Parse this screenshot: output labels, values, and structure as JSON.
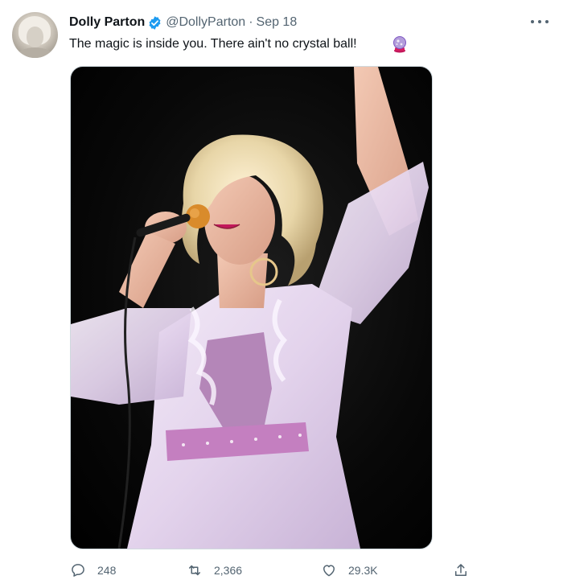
{
  "author": {
    "name": "Dolly Parton",
    "handle": "@DollyParton",
    "separator": "·",
    "timestamp": "Sep 18",
    "verified": true
  },
  "tweet": {
    "text": "The magic is inside you. There ain't no crystal ball!",
    "emoji": "crystal-ball-icon"
  },
  "actions": {
    "replies": "248",
    "retweets": "2,366",
    "likes": "29.3K"
  },
  "colors": {
    "verified": "#1d9bf0",
    "muted_text": "#536471",
    "text": "#0f1419"
  }
}
